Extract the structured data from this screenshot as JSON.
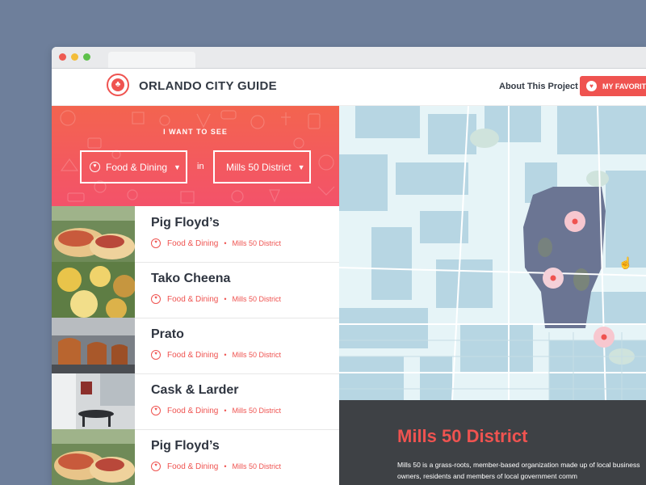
{
  "header": {
    "title": "ORLANDO CITY GUIDE",
    "about_label": "About This Project",
    "favorites_label": "MY FAVORITES"
  },
  "filters": {
    "heading": "I WANT TO SEE",
    "category": "Food & Dining",
    "connector": "in",
    "district": "Mills 50 District"
  },
  "listings": [
    {
      "name": "Pig Floyd’s",
      "category": "Food & Dining",
      "district": "Mills 50 District"
    },
    {
      "name": "Tako Cheena",
      "category": "Food & Dining",
      "district": "Mills 50 District"
    },
    {
      "name": "Prato",
      "category": "Food & Dining",
      "district": "Mills 50 District"
    },
    {
      "name": "Cask & Larder",
      "category": "Food & Dining",
      "district": "Mills 50 District"
    },
    {
      "name": "Pig Floyd’s",
      "category": "Food & Dining",
      "district": "Mills 50 District"
    }
  ],
  "info_panel": {
    "title": "Mills 50 District",
    "description": "Mills 50 is a grass-roots, member-based organization made up of local business owners, residents and members of local government comm"
  },
  "colors": {
    "accent": "#ef5350",
    "map_highlight": "#6b7593",
    "map_blocks": "#b7d6e3",
    "info_bg": "#3e4145"
  },
  "icons": {
    "heart": "heart-icon",
    "caret": "caret-down-icon",
    "cursor": "hand-cursor-icon"
  }
}
